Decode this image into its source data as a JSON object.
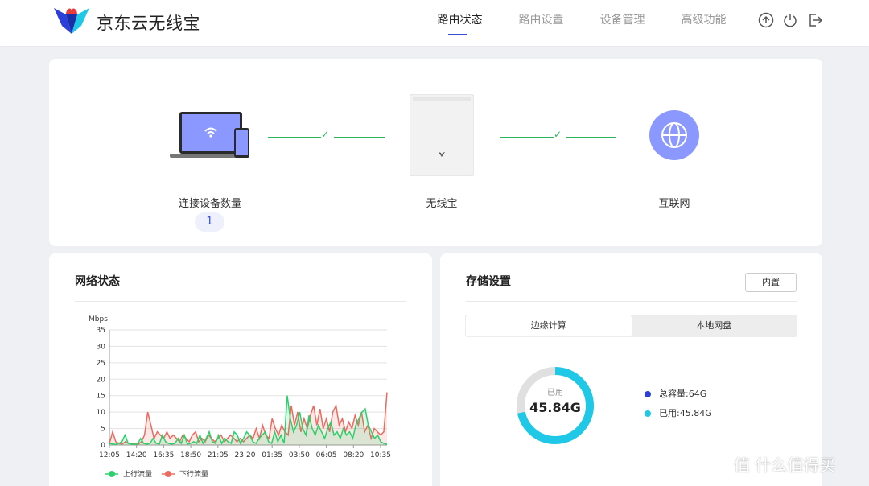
{
  "header": {
    "app_title": "京东云无线宝",
    "nav": [
      {
        "label": "路由状态",
        "active": true
      },
      {
        "label": "路由设置",
        "active": false
      },
      {
        "label": "设备管理",
        "active": false
      },
      {
        "label": "高级功能",
        "active": false
      }
    ],
    "icons": [
      "upgrade-icon",
      "power-icon",
      "logout-icon"
    ]
  },
  "topology": {
    "devices_label": "连接设备数量",
    "device_count": "1",
    "router_label": "无线宝",
    "internet_label": "互联网",
    "link_check": "✓"
  },
  "network": {
    "title": "网络状态"
  },
  "storage": {
    "title": "存储设置",
    "mode_button": "内置",
    "tabs": [
      {
        "label": "边缘计算",
        "active": true
      },
      {
        "label": "本地网盘",
        "active": false
      }
    ],
    "used_caption": "已用",
    "used_value": "45.84G",
    "used_fraction": 0.716,
    "legend": [
      {
        "label": "总容量:64G",
        "color": "#2c3fd8"
      },
      {
        "label": "已用:45.84G",
        "color": "#1ec8e6"
      }
    ]
  },
  "watermark": "值 什么值得买",
  "colors": {
    "accent": "#3a4ad9",
    "link_green": "#2bb55a",
    "upload": "#2bd16a",
    "download": "#ec6a5e",
    "donut_used": "#1ec8e6",
    "donut_free": "#e0e0e0"
  },
  "chart_data": {
    "type": "area",
    "ylabel": "Mbps",
    "ylim": [
      0,
      35
    ],
    "yticks": [
      0,
      5,
      10,
      15,
      20,
      25,
      30,
      35
    ],
    "xticks": [
      "12:05",
      "14:20",
      "16:35",
      "18:50",
      "21:05",
      "23:20",
      "01:35",
      "03:50",
      "06:05",
      "08:20",
      "10:35"
    ],
    "grid": true,
    "legend_position": "bottom",
    "series": [
      {
        "name": "上行流量",
        "color": "#2bd16a",
        "values": [
          0.5,
          0.3,
          0.2,
          0.5,
          1,
          3,
          0.5,
          0.3,
          0.2,
          0.3,
          2,
          0.5,
          0.3,
          0.5,
          2,
          0.5,
          0.3,
          3,
          1,
          0.5,
          0.3,
          0.5,
          2,
          0.5,
          3,
          0.3,
          0.5,
          1,
          0.5,
          3,
          0.5,
          2,
          4,
          1,
          0.5,
          3,
          0.5,
          2,
          1,
          0.5,
          4,
          3,
          0.5,
          2,
          4,
          3,
          1,
          0.5,
          2,
          3,
          4,
          1,
          0.5,
          4,
          1,
          3,
          0.5,
          15,
          8,
          4,
          6,
          10,
          5,
          3,
          9,
          5,
          3,
          6,
          4,
          2,
          5,
          7,
          3,
          4,
          2,
          5,
          3,
          4,
          2,
          6,
          8,
          10,
          11,
          6,
          4,
          2,
          3,
          1,
          0.5,
          0.2
        ]
      },
      {
        "name": "下行流量",
        "color": "#ec6a5e",
        "values": [
          0.5,
          4,
          1,
          0.5,
          0.3,
          1,
          0.5,
          0.5,
          0.3,
          0.2,
          1,
          3,
          10,
          6,
          2,
          4,
          3,
          2,
          4,
          2,
          3,
          2,
          1,
          3,
          2,
          1,
          3,
          4,
          1,
          2,
          1,
          3,
          2,
          1,
          2,
          3,
          1,
          2,
          3,
          2,
          1,
          2,
          1,
          2,
          3,
          2,
          5,
          2,
          6,
          3,
          2,
          8,
          5,
          3,
          6,
          4,
          3,
          12,
          6,
          10,
          4,
          8,
          5,
          9,
          12,
          6,
          11,
          5,
          8,
          4,
          10,
          12,
          6,
          8,
          4,
          7,
          5,
          9,
          6,
          10,
          4,
          6,
          2,
          5,
          4,
          3,
          4,
          16
        ]
      }
    ]
  }
}
